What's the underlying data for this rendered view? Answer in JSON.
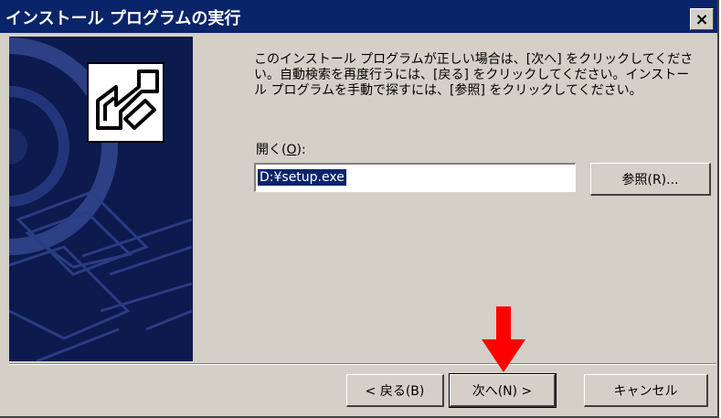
{
  "window": {
    "title": "インストール プログラムの実行",
    "close_glyph": "×"
  },
  "instructions": {
    "line1": "このインストール プログラムが正しい場合は、[次へ] をクリックしてくださ",
    "line2": "い。自動検索を再度行うには、[戻る] をクリックしてください。インストー",
    "line3": "ル プログラムを手動で探すには、[参照] をクリックしてください。"
  },
  "open_field": {
    "label_before": "開く(",
    "label_accel": "O",
    "label_after": "):",
    "value": "D:¥setup.exe"
  },
  "buttons": {
    "browse": "参照(R)...",
    "back": "< 戻る(B)",
    "next": "次へ(N) >",
    "cancel": "キャンセル"
  },
  "colors": {
    "title_bar": "#0a246a",
    "side_panel": "#0c1a4e",
    "dialog_face": "#d4d0c8",
    "annotation_arrow": "#ff0000"
  },
  "icons": {
    "wizard_logo": "install-arrow-icon",
    "annotation": "red-down-arrow-icon"
  }
}
